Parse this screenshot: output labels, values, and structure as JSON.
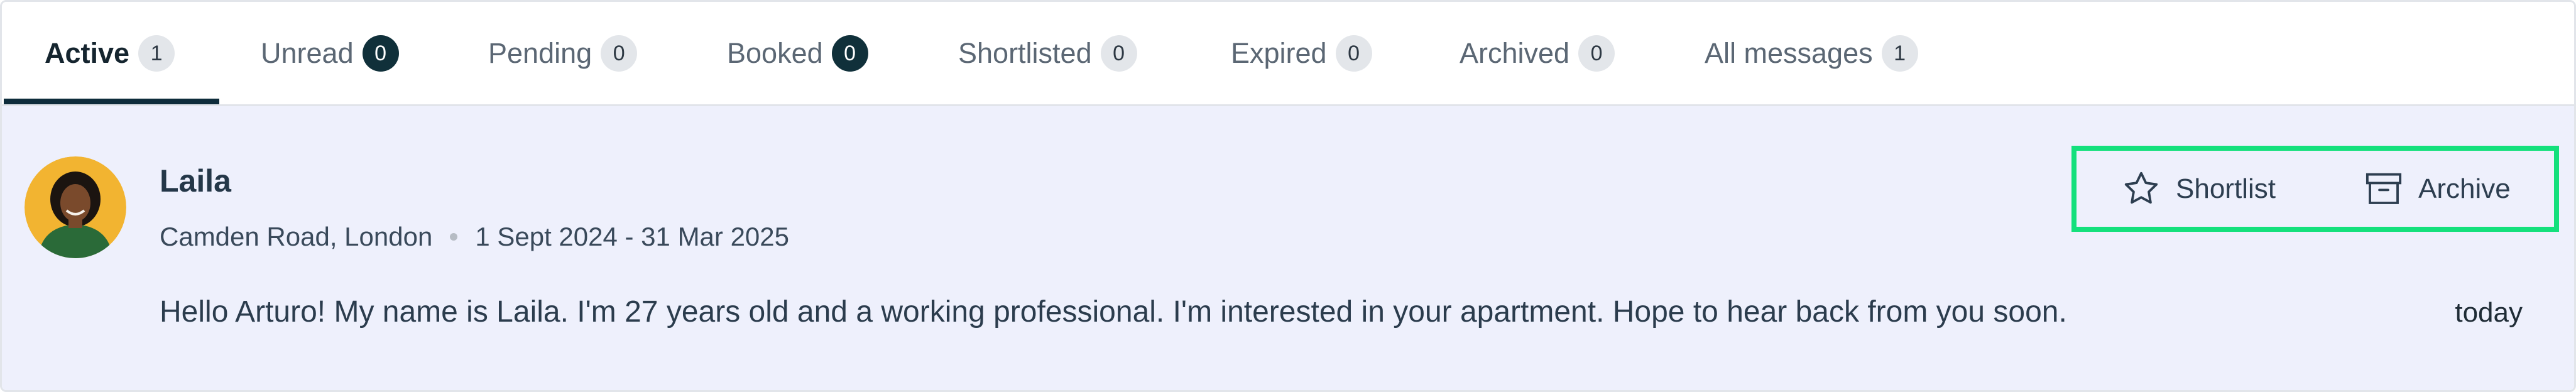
{
  "tabs": [
    {
      "label": "Active",
      "count": "1",
      "dark": false
    },
    {
      "label": "Unread",
      "count": "0",
      "dark": true
    },
    {
      "label": "Pending",
      "count": "0",
      "dark": false
    },
    {
      "label": "Booked",
      "count": "0",
      "dark": true
    },
    {
      "label": "Shortlisted",
      "count": "0",
      "dark": false
    },
    {
      "label": "Expired",
      "count": "0",
      "dark": false
    },
    {
      "label": "Archived",
      "count": "0",
      "dark": false
    },
    {
      "label": "All messages",
      "count": "1",
      "dark": false
    }
  ],
  "conversation": {
    "name": "Laila",
    "location": "Camden Road, London",
    "dates": "1 Sept 2024 - 31 Mar 2025",
    "message": "Hello Arturo! My name is Laila. I'm 27 years old and a working professional. I'm interested in your apartment. Hope to hear back from you soon.",
    "time": "today"
  },
  "actions": {
    "shortlist": "Shortlist",
    "archive": "Archive"
  },
  "colors": {
    "row_background": "#eef0fc",
    "accent_dark": "#0e2c3b",
    "highlight_green": "#14e07c",
    "avatar_background": "#f2b431"
  }
}
